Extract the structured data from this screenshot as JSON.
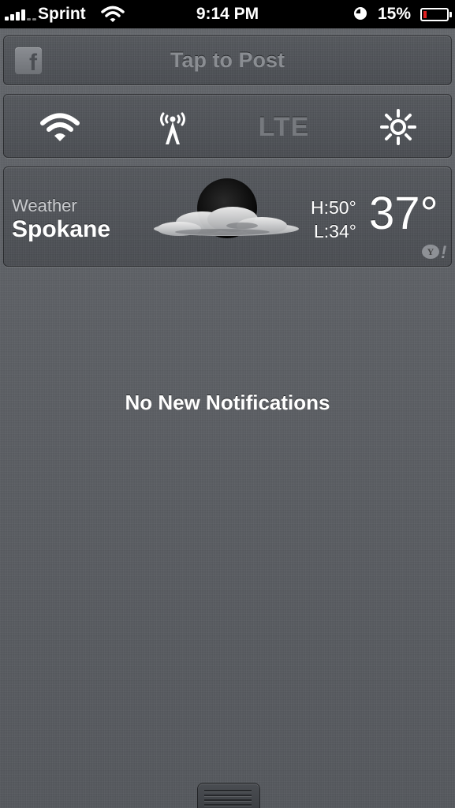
{
  "status_bar": {
    "carrier": "Sprint",
    "time": "9:14 PM",
    "battery_percent": "15%",
    "battery_level": 0.15,
    "signal_bars": 4,
    "icons": [
      "signal-bars-icon",
      "wifi-icon",
      "clock-icon",
      "battery-icon"
    ]
  },
  "post_widget": {
    "label": "Tap to Post",
    "icon": "facebook-icon",
    "icon_letter": "f"
  },
  "toggles": {
    "wifi_icon": "wifi-icon",
    "cellular_icon": "cellular-tower-icon",
    "lte_label": "LTE",
    "brightness_icon": "brightness-icon"
  },
  "weather": {
    "app_label": "Weather",
    "city": "Spokane",
    "high": "H:50°",
    "low": "L:34°",
    "temperature": "37°",
    "condition_icon": "partly-cloudy-night-icon",
    "provider_icon": "yahoo-icon",
    "provider_letter": "Y",
    "provider_mark": "!"
  },
  "notifications": {
    "empty_message": "No New Notifications"
  },
  "handle": {
    "icon": "pull-handle-icon"
  },
  "colors": {
    "background": "#5c5f64",
    "status_bar": "#000000",
    "battery_low": "#e02020",
    "text_primary": "#ffffff",
    "text_muted": "#8a8d92"
  }
}
